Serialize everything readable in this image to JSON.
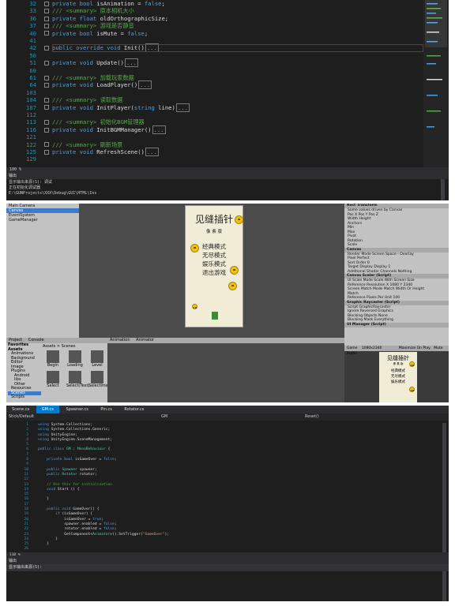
{
  "editor1": {
    "lines": [
      {
        "n": "32",
        "parts": [
          [
            "kw",
            "private bool "
          ],
          [
            "tx",
            "isAnimation = "
          ],
          [
            "kw",
            "false"
          ],
          [
            "tx",
            ";"
          ]
        ]
      },
      {
        "n": "33",
        "parts": [
          [
            "cm",
            "/// <summary> 原本相机大小"
          ]
        ]
      },
      {
        "n": "36",
        "parts": [
          [
            "kw",
            "private float "
          ],
          [
            "tx",
            "oldOrthographicSize;"
          ]
        ]
      },
      {
        "n": "37",
        "parts": [
          [
            "cm",
            "/// <summary> 游戏是否静音"
          ]
        ]
      },
      {
        "n": "40",
        "parts": [
          [
            "kw",
            "private bool "
          ],
          [
            "tx",
            "isMute = "
          ],
          [
            "kw",
            "false"
          ],
          [
            "tx",
            ";"
          ]
        ]
      },
      {
        "n": "41",
        "parts": []
      },
      {
        "n": "42",
        "parts": [
          [
            "kw",
            "public override void "
          ],
          [
            "tx",
            "Init()"
          ],
          [
            "tx",
            "[...]"
          ]
        ]
      },
      {
        "n": "50",
        "parts": []
      },
      {
        "n": "51",
        "parts": [
          [
            "kw",
            "private void "
          ],
          [
            "tx",
            "Update()"
          ],
          [
            "tx",
            "[...]"
          ]
        ]
      },
      {
        "n": "60",
        "parts": []
      },
      {
        "n": "61",
        "parts": [
          [
            "cm",
            "/// <summary> 加载玩家数据"
          ]
        ]
      },
      {
        "n": "64",
        "parts": [
          [
            "kw",
            "private void "
          ],
          [
            "tx",
            "LoadPlayer()"
          ],
          [
            "tx",
            "[...]"
          ]
        ]
      },
      {
        "n": "103",
        "parts": []
      },
      {
        "n": "104",
        "parts": [
          [
            "cm",
            "/// <summary> 读取数据"
          ]
        ]
      },
      {
        "n": "107",
        "parts": [
          [
            "kw",
            "private void "
          ],
          [
            "tx",
            "InitPlayer("
          ],
          [
            "kw",
            "string "
          ],
          [
            "tx",
            "line)"
          ],
          [
            "tx",
            "[...]"
          ]
        ]
      },
      {
        "n": "112",
        "parts": []
      },
      {
        "n": "113",
        "parts": [
          [
            "cm",
            "/// <summary> 初始化BGM管理器"
          ]
        ]
      },
      {
        "n": "116",
        "parts": [
          [
            "kw",
            "private void "
          ],
          [
            "tx",
            "InitBGMManager()"
          ],
          [
            "tx",
            "[...]"
          ]
        ]
      },
      {
        "n": "121",
        "parts": []
      },
      {
        "n": "122",
        "parts": [
          [
            "cm",
            "/// <summary> 刷新场景"
          ]
        ]
      },
      {
        "n": "125",
        "parts": [
          [
            "kw",
            "private void "
          ],
          [
            "tx",
            "RefreshScene()"
          ],
          [
            "tx",
            "[...]"
          ]
        ]
      },
      {
        "n": "129",
        "parts": []
      }
    ],
    "zoom": "100 %",
    "output_title": "输出",
    "output_source": "显示输出来源(S): 调试",
    "output_lines": [
      "正在初始化调试器",
      "E:\\GUNProjects\\XXX\\Debug\\GUI\\HTML\\Ins"
    ]
  },
  "unity": {
    "hierarchy_items": [
      "Main Camera",
      "Canvas",
      "EventSystem",
      "GameManager"
    ],
    "game": {
      "title": "见缝插针",
      "subtitle": "像 素 版",
      "options": [
        "经典模式",
        "无尽模式",
        "娱乐模式",
        "退出游戏"
      ],
      "title_small": "见缝插针",
      "subtitle_small": "像 素 版",
      "options_small": [
        "经典模式",
        "无尽模式",
        "娱乐模式"
      ]
    },
    "inspector": {
      "rect_label": "Rect Transform",
      "rows1": [
        "Some values driven by Canvas",
        "Pos X   Pos Y   Pos Z",
        "Width   Height",
        "Anchors",
        "Min",
        "Max",
        "Pivot",
        "Rotation",
        "Scale"
      ],
      "canvas_label": "Canvas",
      "rows2": [
        "Render Mode   Screen Space - Overlay",
        "Pixel Perfect",
        "Sort Order   0",
        "Target Display   Display 1",
        "Additional Shader Channels   Nothing"
      ],
      "scaler_label": "Canvas Scaler (Script)",
      "rows3": [
        "UI Scale Mode   Scale With Screen Size",
        "Reference Resolution   X 1080   Y 2340",
        "Screen Match Mode   Match Width Or Height",
        "Match",
        "Reference Pixels Per Unit   100"
      ],
      "raycaster_label": "Graphic Raycaster (Script)",
      "rows4": [
        "Script   GraphicRaycaster",
        "Ignore Reversed Graphics",
        "Blocking Objects   None",
        "Blocking Mask   Everything"
      ],
      "manager_label": "UI Manager (Script)"
    },
    "project": {
      "tabs": [
        "Project",
        "Console"
      ],
      "favorites": "Favorites",
      "folders": [
        "Assets",
        "Animations",
        "Background",
        "Editor",
        "Image",
        "Plugins",
        "Android",
        "libs",
        "Other",
        "Resources",
        "Scenes",
        "Scripts"
      ],
      "breadcrumb": "Assets > Scenes",
      "scenes": [
        "Begin",
        "Loading",
        "Level",
        "Select",
        "Select(Text)",
        "SelectImage"
      ]
    },
    "anim_tabs": [
      "Animation",
      "Animator"
    ],
    "game_tab": "Game",
    "game_res": "1080x2340",
    "game_controls": [
      "Maximize On Play",
      "Mute Audio"
    ]
  },
  "editor2": {
    "tabs": [
      "Scene.cs",
      "GM.cs",
      "Spawner.cs",
      "Pin.cs",
      "Rotator.cs"
    ],
    "active_tab": 1,
    "nav_left": "Stick/Default",
    "nav_mid": "GM",
    "nav_right": "Reset()",
    "lines": [
      {
        "n": "1",
        "parts": [
          [
            "kw",
            "using "
          ],
          [
            "tx",
            "System.Collections;"
          ]
        ]
      },
      {
        "n": "2",
        "parts": [
          [
            "kw",
            "using "
          ],
          [
            "tx",
            "System.Collections.Generic;"
          ]
        ]
      },
      {
        "n": "3",
        "parts": [
          [
            "kw",
            "using "
          ],
          [
            "tx",
            "UnityEngine;"
          ]
        ]
      },
      {
        "n": "4",
        "parts": [
          [
            "kw",
            "using "
          ],
          [
            "tx",
            "UnityEngine.SceneManagement;"
          ]
        ]
      },
      {
        "n": "5",
        "parts": []
      },
      {
        "n": "6",
        "parts": [
          [
            "kw",
            "public class "
          ],
          [
            "ty",
            "GM"
          ],
          [
            "tx",
            " : "
          ],
          [
            "ty",
            "MonoBehaviour"
          ],
          [
            "tx",
            " {"
          ]
        ]
      },
      {
        "n": "7",
        "parts": []
      },
      {
        "n": "8",
        "parts": [
          [
            "kw",
            "    private bool "
          ],
          [
            "tx",
            "isGameOver = "
          ],
          [
            "kw",
            "false"
          ],
          [
            "tx",
            ";"
          ]
        ]
      },
      {
        "n": "9",
        "parts": []
      },
      {
        "n": "10",
        "parts": [
          [
            "kw",
            "    public "
          ],
          [
            "ty",
            "Spawner "
          ],
          [
            "tx",
            "spawner;"
          ]
        ]
      },
      {
        "n": "11",
        "parts": [
          [
            "kw",
            "    public "
          ],
          [
            "ty",
            "Rotator "
          ],
          [
            "tx",
            "rotator;"
          ]
        ]
      },
      {
        "n": "12",
        "parts": []
      },
      {
        "n": "13",
        "parts": [
          [
            "cm",
            "    // Use this for initialization"
          ]
        ]
      },
      {
        "n": "14",
        "parts": [
          [
            "kw",
            "    void "
          ],
          [
            "tx",
            "Start () {"
          ]
        ]
      },
      {
        "n": "15",
        "parts": []
      },
      {
        "n": "16",
        "parts": [
          [
            "tx",
            "    }"
          ]
        ]
      },
      {
        "n": "17",
        "parts": []
      },
      {
        "n": "18",
        "parts": [
          [
            "kw",
            "    public void "
          ],
          [
            "tx",
            "GameOver() {"
          ]
        ]
      },
      {
        "n": "19",
        "parts": [
          [
            "kw",
            "        if "
          ],
          [
            "tx",
            "(isGameOver) {"
          ]
        ]
      },
      {
        "n": "20",
        "parts": [
          [
            "tx",
            "            isGameOver = "
          ],
          [
            "kw",
            "true"
          ],
          [
            "tx",
            ";"
          ]
        ]
      },
      {
        "n": "21",
        "parts": [
          [
            "tx",
            "            spawner.enabled = "
          ],
          [
            "kw",
            "false"
          ],
          [
            "tx",
            ";"
          ]
        ]
      },
      {
        "n": "22",
        "parts": [
          [
            "tx",
            "            rotator.enabled = "
          ],
          [
            "kw",
            "false"
          ],
          [
            "tx",
            ";"
          ]
        ]
      },
      {
        "n": "23",
        "parts": [
          [
            "tx",
            "            GetComponent<"
          ],
          [
            "ty",
            "Animator"
          ],
          [
            "tx",
            ">().SetTrigger("
          ],
          [
            "st",
            "\"GameOver\""
          ],
          [
            "tx",
            ");"
          ]
        ]
      },
      {
        "n": "24",
        "parts": [
          [
            "tx",
            "        }"
          ]
        ]
      },
      {
        "n": "25",
        "parts": [
          [
            "tx",
            "    }"
          ]
        ]
      },
      {
        "n": "26",
        "parts": []
      }
    ],
    "zoom": "110 %",
    "output_title": "输出",
    "output_source": "显示输出来源(S):"
  }
}
